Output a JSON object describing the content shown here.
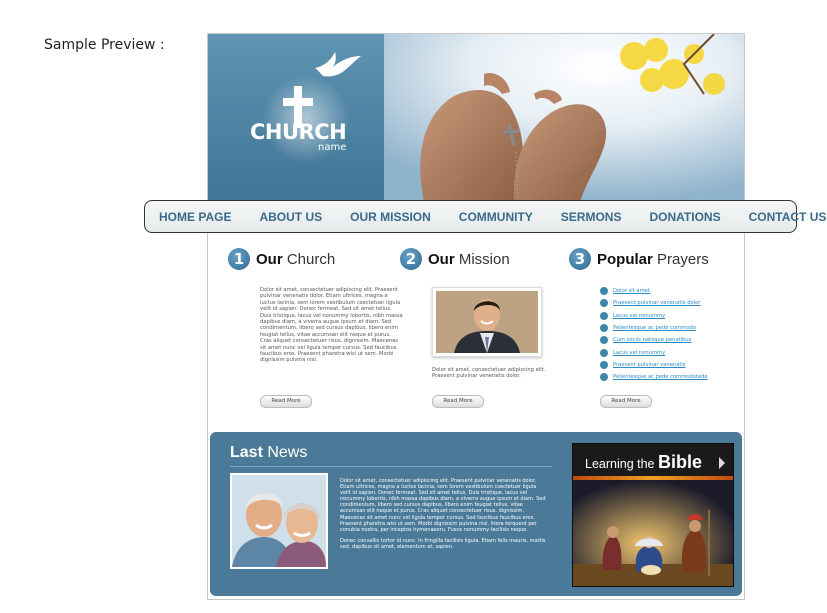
{
  "caption": "Sample Preview :",
  "logo": {
    "word": "CHURCH",
    "sub": "name"
  },
  "nav": [
    "HOME PAGE",
    "ABOUT US",
    "OUR MISSION",
    "COMMUNITY",
    "SERMONS",
    "DONATIONS",
    "CONTACT US"
  ],
  "columns": [
    {
      "number": "1",
      "title_bold": "Our",
      "title_rest": " Church",
      "text": "Dolor sit amet, consectetuer adipiscing elit. Praesent pulvinar venenatis dolor. Etiam ultrices, magna a luctus lacinia, sem lorem vestibulum csectetuer ligula velit id sapien. Donec fermeat. Sed sit amet tellus. Duis tristique, lacus vel nonummy lobortis, nibh massa dapibus diam, a viverra augue ipsum et diam. Sed condimentum, libero sed cursus dapibus, libero enim feugiat tellus, vitae accumsan elit neque et purus. Cras aliquet consectetuer risus. dignissim. Maecenas sit amet nunc vel ligula tempor cursus. Sed faucibus faucibus eros. Praesent pharetra wisi ut sem. Morbi dignissim pulvina nisl.",
      "button": "Read More"
    },
    {
      "number": "2",
      "title_bold": "Our",
      "title_rest": " Mission",
      "text": "Dolor sit amet, consectetuer adipiscing elit. Praesent pulvinar venenatis dolor.",
      "button": "Read More"
    },
    {
      "number": "3",
      "title_bold": "Popular",
      "title_rest": " Prayers",
      "links": [
        "Dolor sit amet",
        "Praesent pulvinar venenatis dolor",
        "Lacus vel nonummy",
        "Pellentesque ac pede commodo",
        "Cum sociis natoque penatibus",
        "Lacus vel nonummy",
        "Praesent pulvinar venenatis",
        "Pellentesque ac pede commodotede"
      ],
      "button": "Read More"
    }
  ],
  "news": {
    "title_bold": "Last",
    "title_rest": " News",
    "text": "Dolor sit amet, consectetuer adipiscing elit. Praesent pulvinar venenatis dolor. Etiam ultrices, magna a luctus lacinia, sem lorem vestibulum csectetuer ligula velit id sapien. Donec fermeat. Sed sit amet tellus. Duis tristique, lacus vel nonummy lobortis, nibh massa dapibus diam, a viverra augue ipsum et diam. Sed condimentum, libero sed cursus dapibus, libero enim feugiat tellus, vitae accumsan elit neque et purus. Cras aliquet consectetuer risus. dignissim. Maecenas sit amet nunc vel ligula tempor cursus. Sed faucibus faucibus eros. Praesent pharetra wisi ut sem. Morbi dignissim pulvina nisl. litora torquent per conubia nostra, per inceptos hymenaeoru. Fusce nonummy facilisis neque.",
    "text2": "Donec convallis tortor id nunc. In fringilla facilisis ligula. Etiam felis mauris, mattis sed, dapibus sit amet, elementum at, sapien."
  },
  "bible_banner": {
    "prefix": "Learning the ",
    "bold": "Bible"
  },
  "colors": {
    "nav_text": "#3a6a8a",
    "panel": "#4a7a98",
    "accent": "#2b6890",
    "link": "#2a8cc7"
  }
}
